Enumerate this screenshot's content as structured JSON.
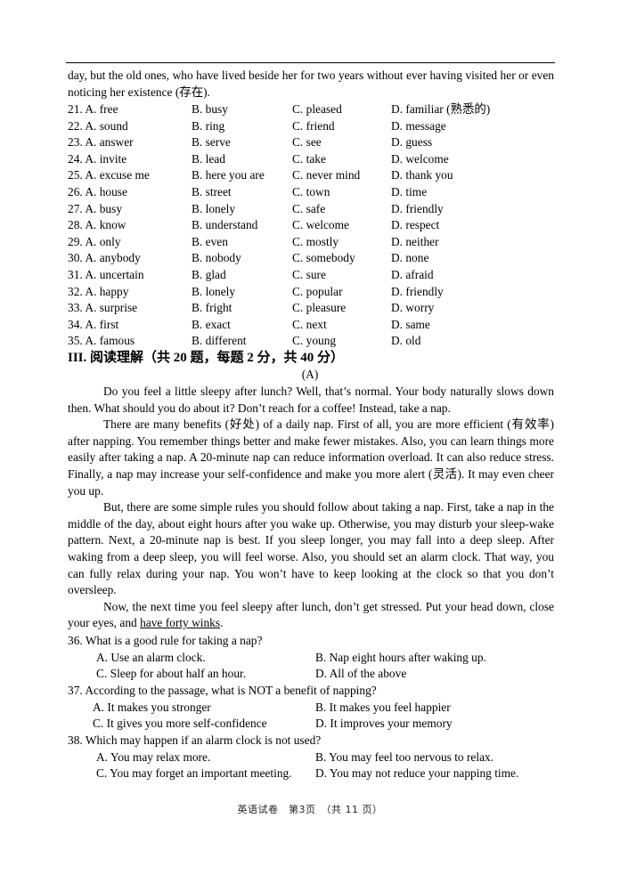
{
  "continuation": {
    "text": "day, but the old ones, who have lived beside her for two years without ever having visited her or even noticing her existence (存在)."
  },
  "cloze_options": [
    {
      "num": "21.",
      "A": "A. free",
      "B": "B. busy",
      "C": "C. pleased",
      "D": "D. familiar (熟悉的)"
    },
    {
      "num": "22.",
      "A": "A. sound",
      "B": "B. ring",
      "C": "C. friend",
      "D": "D. message"
    },
    {
      "num": "23.",
      "A": "A. answer",
      "B": "B. serve",
      "C": "C. see",
      "D": "D. guess"
    },
    {
      "num": "24.",
      "A": "A. invite",
      "B": "B. lead",
      "C": "C. take",
      "D": "D. welcome"
    },
    {
      "num": "25.",
      "A": "A. excuse me",
      "B": "B. here you are",
      "C": "C. never mind",
      "D": "D. thank you"
    },
    {
      "num": "26.",
      "A": "A. house",
      "B": "B. street",
      "C": "C. town",
      "D": "D. time"
    },
    {
      "num": "27.",
      "A": "A. busy",
      "B": "B. lonely",
      "C": "C. safe",
      "D": "D. friendly"
    },
    {
      "num": "28.",
      "A": "A. know",
      "B": "B. understand",
      "C": "C. welcome",
      "D": "D. respect"
    },
    {
      "num": "29.",
      "A": "A. only",
      "B": "B. even",
      "C": "C. mostly",
      "D": "D. neither"
    },
    {
      "num": "30.",
      "A": "A. anybody",
      "B": "B. nobody",
      "C": "C. somebody",
      "D": "D. none"
    },
    {
      "num": "31.",
      "A": "A. uncertain",
      "B": "B. glad",
      "C": "C. sure",
      "D": "D. afraid"
    },
    {
      "num": "32.",
      "A": "A. happy",
      "B": "B. lonely",
      "C": "C. popular",
      "D": "D. friendly"
    },
    {
      "num": "33.",
      "A": "A. surprise",
      "B": "B. fright",
      "C": "C. pleasure",
      "D": "D. worry"
    },
    {
      "num": "34.",
      "A": "A. first",
      "B": "B. exact",
      "C": "C. next",
      "D": "D. same"
    },
    {
      "num": "35.",
      "A": "A. famous",
      "B": "B. different",
      "C": "C. young",
      "D": "D. old"
    }
  ],
  "section": {
    "title": "III. 阅读理解（共 20 题，每题 2 分，共 40 分）",
    "sub": "(A)"
  },
  "passage": {
    "p1": "Do you feel a little sleepy after lunch? Well, that’s normal. Your body naturally slows down then. What should you do about it? Don’t reach for a coffee! Instead, take a nap.",
    "p2": "There are many benefits (好处) of a daily nap. First of all, you are more efficient (有效率) after napping. You remember things better and make fewer mistakes. Also, you can learn things more easily after taking a nap. A 20-minute nap can reduce information overload. It can also reduce stress. Finally, a nap may increase your self-confidence and make you more alert (灵活). It may even cheer you up.",
    "p3": "But, there are some simple rules you should follow about taking a nap. First, take a nap in the middle of the day, about eight hours after you wake up. Otherwise, you may disturb your sleep-wake pattern. Next, a 20-minute nap is best. If you sleep longer, you may fall into a deep sleep. After waking from a deep sleep, you will feel worse. Also, you should set an alarm clock. That way, you can fully relax during your nap. You won’t have to keep looking at the clock so that you don’t oversleep.",
    "p4_before": "Now, the next time you feel sleepy after lunch, don’t get stressed. Put your head down, close your eyes, and ",
    "p4_underlined": "have forty winks",
    "p4_after": "."
  },
  "questions": [
    {
      "stem": "36. What is a good rule for taking a nap?",
      "A": "A. Use an alarm clock.",
      "B": "B. Nap eight hours after waking up.",
      "C": "C. Sleep for about half an hour.",
      "D": "D. All of the above"
    },
    {
      "stem": "37. According to the passage, what is NOT a benefit of napping?",
      "A": "A. It makes you stronger",
      "B": "B. It makes you feel happier",
      "C": "C. It gives you more self-confidence",
      "D": "D. It improves your memory"
    },
    {
      "stem": "38. Which may happen if an alarm clock is not used?",
      "A": "A. You may relax more.",
      "B": "B. You may feel too nervous to relax.",
      "C": "C. You may forget an important meeting.",
      "D": "D. You may not reduce your napping time."
    }
  ],
  "footer": {
    "text": "英语试卷　第3页　（共 11 页）"
  }
}
